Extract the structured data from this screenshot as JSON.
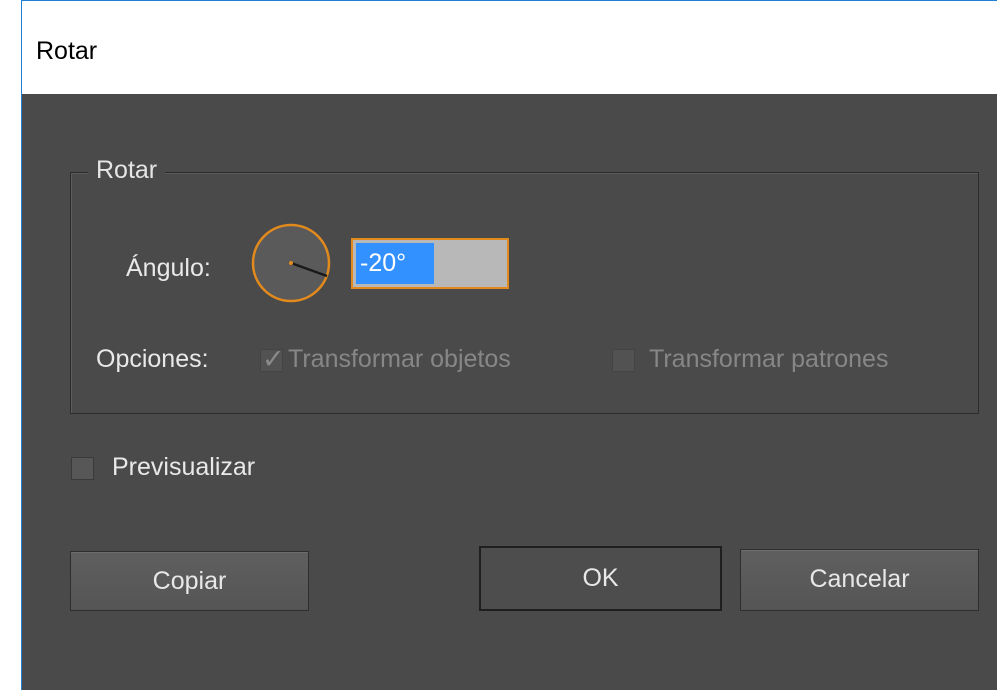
{
  "window": {
    "title": "Rotar"
  },
  "rotate_group": {
    "legend": "Rotar",
    "angle_label": "Ángulo:",
    "angle_value": "-20°",
    "options_label": "Opciones:",
    "transform_objects": {
      "label": "Transformar objetos",
      "checked": true,
      "enabled": false
    },
    "transform_patterns": {
      "label": "Transformar patrones",
      "checked": false,
      "enabled": false
    }
  },
  "preview": {
    "label": "Previsualizar",
    "checked": false
  },
  "buttons": {
    "copy": "Copiar",
    "ok": "OK",
    "cancel": "Cancelar"
  },
  "colors": {
    "accent": "#e38a1d",
    "selection": "#3391ff",
    "dialog_bg": "#4a4a4a"
  }
}
